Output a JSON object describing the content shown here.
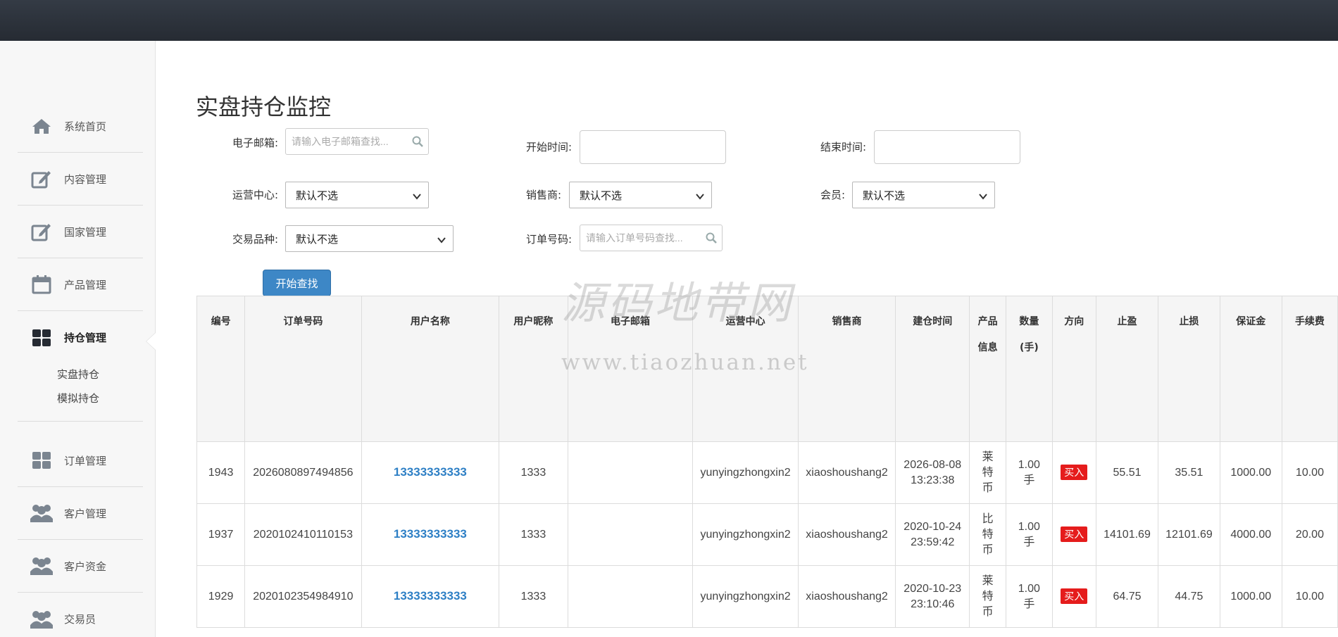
{
  "page": {
    "title": "实盘持仓监控"
  },
  "sidebar": {
    "items": [
      {
        "label": "系统首页",
        "icon": "home-icon"
      },
      {
        "label": "内容管理",
        "icon": "edit-icon"
      },
      {
        "label": "国家管理",
        "icon": "edit-icon"
      },
      {
        "label": "产品管理",
        "icon": "calendar-icon"
      },
      {
        "label": "持仓管理",
        "icon": "dashboard-icon",
        "active": true
      },
      {
        "label": "订单管理",
        "icon": "dashboard-icon"
      },
      {
        "label": "客户管理",
        "icon": "users-icon"
      },
      {
        "label": "客户资金",
        "icon": "users-icon"
      },
      {
        "label": "交易员",
        "icon": "users-icon"
      }
    ],
    "subitems": [
      {
        "label": "实盘持仓"
      },
      {
        "label": "模拟持仓"
      }
    ]
  },
  "filters": {
    "email_label": "电子邮箱:",
    "email_placeholder": "请输入电子邮箱查找...",
    "start_label": "开始时间:",
    "end_label": "结束时间:",
    "center_label": "运营中心:",
    "center_value": "默认不选",
    "seller_label": "销售商:",
    "seller_value": "默认不选",
    "member_label": "会员:",
    "member_value": "默认不选",
    "product_label": "交易品种:",
    "product_value": "默认不选",
    "order_label": "订单号码:",
    "order_placeholder": "请输入订单号码查找...",
    "search_button": "开始查找"
  },
  "watermark": {
    "line1": "源码地带网",
    "line2": "www.tiaozhuan.net"
  },
  "table": {
    "columns": [
      "编号",
      "订单号码",
      "用户名称",
      "用户昵称",
      "电子邮箱",
      "运营中心",
      "销售商",
      "建仓时间",
      "产品信息",
      "数量(手)",
      "方向",
      "止盈",
      "止损",
      "保证金",
      "手续费"
    ],
    "rows": [
      {
        "id": "1943",
        "order": "2026080897494856",
        "user": "13333333333",
        "nick": "1333",
        "email": "",
        "center": "yunyingzhongxin2",
        "seller": "xiaoshoushang2",
        "date": "2026-08-08",
        "time": "13:23:38",
        "product": "莱特币",
        "qty": "1.00",
        "unit": "手",
        "dir": "买入",
        "tp": "55.51",
        "sl": "35.51",
        "margin": "1000.00",
        "fee": "10.00"
      },
      {
        "id": "1937",
        "order": "2020102410110153",
        "user": "13333333333",
        "nick": "1333",
        "email": "",
        "center": "yunyingzhongxin2",
        "seller": "xiaoshoushang2",
        "date": "2020-10-24",
        "time": "23:59:42",
        "product": "比特币",
        "qty": "1.00",
        "unit": "手",
        "dir": "买入",
        "tp": "14101.69",
        "sl": "12101.69",
        "margin": "4000.00",
        "fee": "20.00"
      },
      {
        "id": "1929",
        "order": "2020102354984910",
        "user": "13333333333",
        "nick": "1333",
        "email": "",
        "center": "yunyingzhongxin2",
        "seller": "xiaoshoushang2",
        "date": "2020-10-23",
        "time": "23:10:46",
        "product": "莱特币",
        "qty": "1.00",
        "unit": "手",
        "dir": "买入",
        "tp": "64.75",
        "sl": "44.75",
        "margin": "1000.00",
        "fee": "10.00"
      }
    ]
  },
  "colors": {
    "accent": "#3d87c6",
    "link": "#2d7fc5",
    "buy_badge": "#e51c1c",
    "topbar": "#2c323b"
  }
}
